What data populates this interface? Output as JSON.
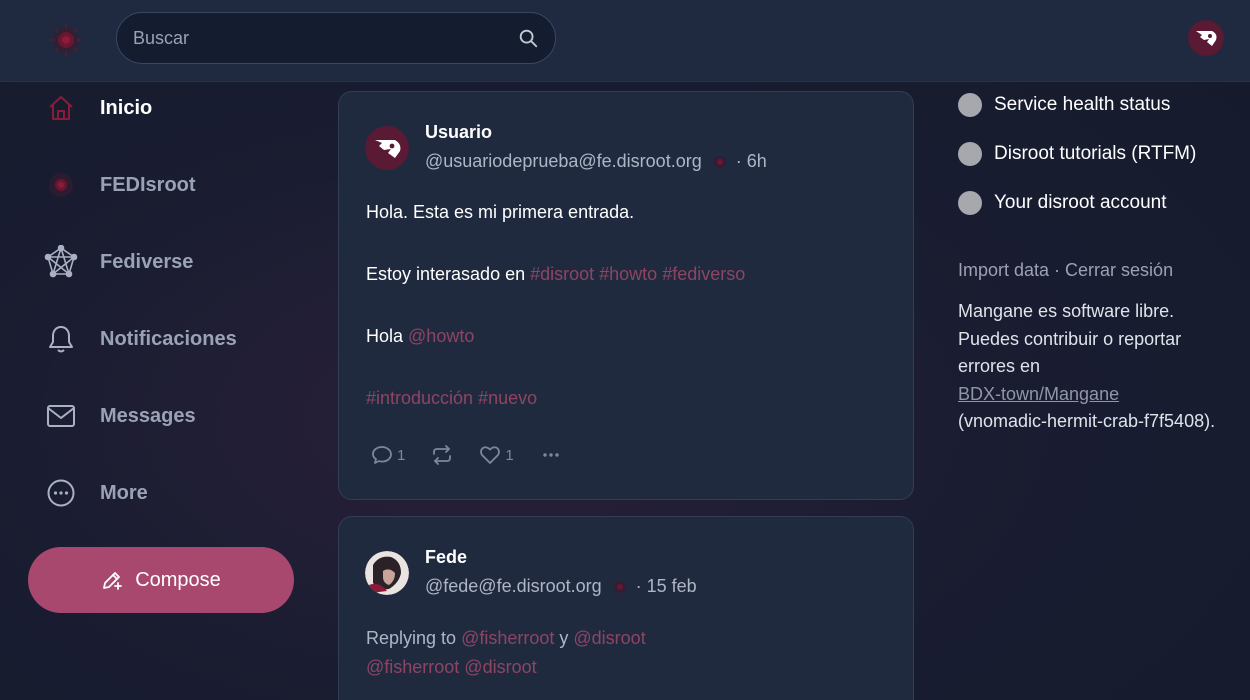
{
  "colors": {
    "accent": "#a8486f",
    "hashtag": "#8d4563",
    "background": "#1a1d31",
    "card": "#202a3f",
    "topbar": "#1f2a40"
  },
  "search": {
    "placeholder": "Buscar",
    "icon": "search-icon"
  },
  "sidebar": {
    "items": [
      {
        "label": "Inicio",
        "icon": "home-icon",
        "active": true
      },
      {
        "label": "FEDIsroot",
        "icon": "fedisroot-icon",
        "active": false
      },
      {
        "label": "Fediverse",
        "icon": "fediverse-icon",
        "active": false
      },
      {
        "label": "Notificaciones",
        "icon": "bell-icon",
        "active": false
      },
      {
        "label": "Messages",
        "icon": "mail-icon",
        "active": false
      },
      {
        "label": "More",
        "icon": "more-icon",
        "active": false
      }
    ],
    "compose_label": "Compose"
  },
  "posts": [
    {
      "display_name": "Usuario",
      "handle": "@usuariodeprueba@fe.disroot.org",
      "time": "· 6h",
      "content": {
        "line1": "Hola. Esta es mi primera entrada.",
        "line2_text": "Estoy interasado en ",
        "line2_tags": "#disroot #howto #fediverso",
        "line3_text": "Hola ",
        "line3_mention": "@howto",
        "line4_tags": "#introducción #nuevo"
      },
      "reply_count": "1",
      "like_count": "1"
    },
    {
      "display_name": "Fede",
      "handle": "@fede@fe.disroot.org",
      "time": "· 15 feb",
      "replying_prefix": "Replying to ",
      "replying_user1": "@fisherroot",
      "replying_conj": " y ",
      "replying_user2": "@disroot",
      "content_mentions": "@fisherroot @disroot"
    }
  ],
  "right": {
    "links": [
      {
        "label": "Service health status"
      },
      {
        "label": "Disroot tutorials (RTFM)"
      },
      {
        "label": "Your disroot account"
      }
    ],
    "import_data": "Import data",
    "footer_sep": " · ",
    "logout": "Cerrar sesión",
    "about_text": "Mangane es software libre. Puedes contribuir o reportar errores en",
    "repo_link": "BDX-town/Mangane",
    "version": "(vnomadic-hermit-crab-f7f5408)."
  }
}
